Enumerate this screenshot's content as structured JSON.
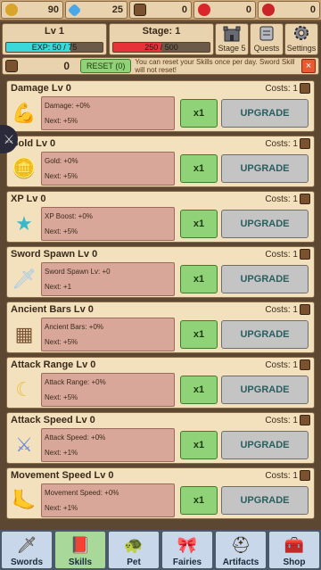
{
  "resources": [
    {
      "name": "gold-coin-icon",
      "value": "90",
      "color": "#d9a42a"
    },
    {
      "name": "gem-icon",
      "value": "25",
      "color": "#4aa8e8"
    },
    {
      "name": "ancient-bar-icon",
      "value": "0",
      "color": "#7a5230"
    },
    {
      "name": "apple-icon",
      "value": "0",
      "color": "#d8262a"
    },
    {
      "name": "red-orb-icon",
      "value": "0",
      "color": "#c8242a"
    }
  ],
  "level": {
    "title": "Lv 1",
    "exp_text": "EXP: 50 / 75",
    "exp_fraction": 0.6667,
    "bar_color": "#3ad8d8"
  },
  "stage": {
    "title": "Stage: 1",
    "hp_text": "250 / 500",
    "hp_fraction": 0.5,
    "bar_color": "#e8323a"
  },
  "nav": [
    {
      "label": "Stage 5",
      "icon": "castle-icon"
    },
    {
      "label": "Quests",
      "icon": "quest-scroll-icon"
    },
    {
      "label": "Settings",
      "icon": "gear-icon"
    }
  ],
  "reset": {
    "count": "0",
    "button_label": "RESET (0)",
    "note": "You can reset your Skills once per day. Sword Skill will not reset!",
    "close_label": "×"
  },
  "skills": [
    {
      "title": "Damage Lv 0",
      "costs": "Costs: 1",
      "icon": "muscle-arm-icon",
      "glyph": "💪",
      "stat": "Damage: +0%",
      "next": "Next: +5%",
      "x1": "x1",
      "upgrade": "UPGRADE"
    },
    {
      "title": "Gold Lv 0",
      "costs": "Costs: 1",
      "icon": "gold-coin-icon",
      "glyph": "🪙",
      "stat": "Gold: +0%",
      "next": "Next: +5%",
      "x1": "x1",
      "upgrade": "UPGRADE"
    },
    {
      "title": "XP Lv 0",
      "costs": "Costs: 1",
      "icon": "star-icon",
      "glyph": "★",
      "stat": "XP Boost: +0%",
      "next": "Next: +5%",
      "x1": "x1",
      "upgrade": "UPGRADE"
    },
    {
      "title": "Sword Spawn Lv 0",
      "costs": "Costs: 1",
      "icon": "sword-spawn-icon",
      "glyph": "🗡",
      "stat": "Sword Spawn Lv: +0",
      "next": "Next: +1",
      "x1": "x1",
      "upgrade": "UPGRADE"
    },
    {
      "title": "Ancient Bars Lv 0",
      "costs": "Costs: 1",
      "icon": "ancient-bar-icon",
      "glyph": "▦",
      "stat": "Ancient Bars: +0%",
      "next": "Next: +5%",
      "x1": "x1",
      "upgrade": "UPGRADE"
    },
    {
      "title": "Attack Range Lv 0",
      "costs": "Costs: 1",
      "icon": "crescent-blade-icon",
      "glyph": "☾",
      "stat": "Attack Range: +0%",
      "next": "Next: +5%",
      "x1": "x1",
      "upgrade": "UPGRADE"
    },
    {
      "title": "Attack Speed Lv 0",
      "costs": "Costs: 1",
      "icon": "dagger-icon",
      "glyph": "⚔",
      "stat": "Attack Speed: +0%",
      "next": "Next: +1%",
      "x1": "x1",
      "upgrade": "UPGRADE"
    },
    {
      "title": "Movement Speed Lv 0",
      "costs": "Costs: 1",
      "icon": "foot-icon",
      "glyph": "🦶",
      "stat": "Movement Speed: +0%",
      "next": "Next: +1%",
      "x1": "x1",
      "upgrade": "UPGRADE"
    }
  ],
  "tabs": [
    {
      "label": "Swords",
      "icon": "sword-icon",
      "glyph": "🗡",
      "active": false
    },
    {
      "label": "Skills",
      "icon": "skill-book-icon",
      "glyph": "📕",
      "active": true
    },
    {
      "label": "Pet",
      "icon": "turtle-icon",
      "glyph": "🐢",
      "active": false
    },
    {
      "label": "Fairies",
      "icon": "ribbon-icon",
      "glyph": "🎀",
      "active": false
    },
    {
      "label": "Artifacts",
      "icon": "helmet-icon",
      "glyph": "⛑",
      "active": false
    },
    {
      "label": "Shop",
      "icon": "chest-icon",
      "glyph": "🧰",
      "active": false
    }
  ]
}
